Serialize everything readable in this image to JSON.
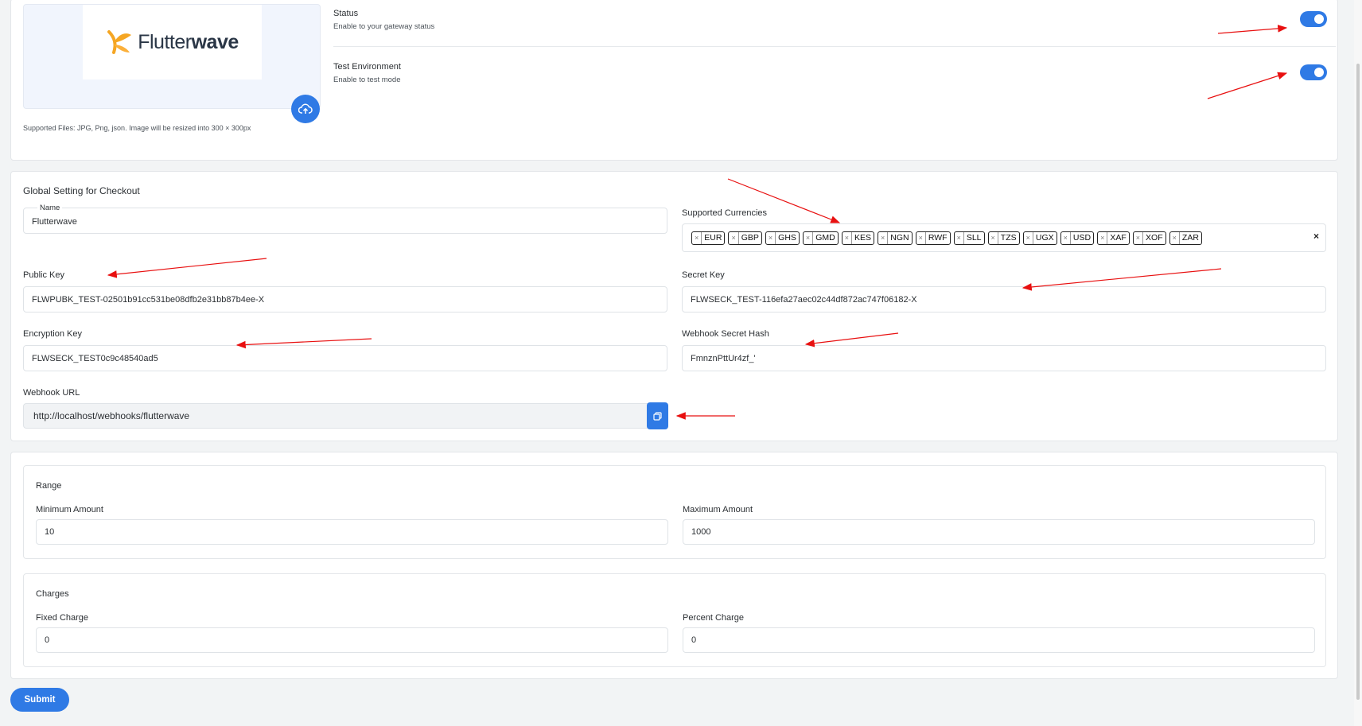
{
  "logo": {
    "text_light": "Flutter",
    "text_bold": "wave"
  },
  "upload": {
    "supported_text": "Supported Files: JPG, Png, json. Image will be resized into 300 × 300px"
  },
  "status": {
    "title": "Status",
    "description": "Enable to your gateway status",
    "enabled": true
  },
  "test_env": {
    "title": "Test Environment",
    "description": "Enable to test mode",
    "enabled": true
  },
  "checkout": {
    "section_title": "Global Setting for Checkout",
    "name_label": "Name",
    "name_value": "Flutterwave",
    "currencies_label": "Supported Currencies",
    "currencies": [
      "EUR",
      "GBP",
      "GHS",
      "GMD",
      "KES",
      "NGN",
      "RWF",
      "SLL",
      "TZS",
      "UGX",
      "USD",
      "XAF",
      "XOF",
      "ZAR"
    ],
    "clear_symbol": "×",
    "public_key_label": "Public Key",
    "public_key_value": "FLWPUBK_TEST-02501b91cc531be08dfb2e31bb87b4ee-X",
    "secret_key_label": "Secret Key",
    "secret_key_value": "FLWSECK_TEST-116efa27aec02c44df872ac747f06182-X",
    "encryption_key_label": "Encryption Key",
    "encryption_key_value": "FLWSECK_TEST0c9c48540ad5",
    "webhook_hash_label": "Webhook Secret Hash",
    "webhook_hash_value": "FmnznPttUr4zf_'",
    "webhook_url_label": "Webhook URL",
    "webhook_url_value": "http://localhost/webhooks/flutterwave"
  },
  "range": {
    "title": "Range",
    "min_label": "Minimum Amount",
    "min_value": "10",
    "max_label": "Maximum Amount",
    "max_value": "1000"
  },
  "charges": {
    "title": "Charges",
    "fixed_label": "Fixed Charge",
    "fixed_value": "0",
    "percent_label": "Percent Charge",
    "percent_value": "0"
  },
  "submit_label": "Submit",
  "colors": {
    "accent": "#2f7ae5",
    "annotation_arrow": "#e81010"
  }
}
